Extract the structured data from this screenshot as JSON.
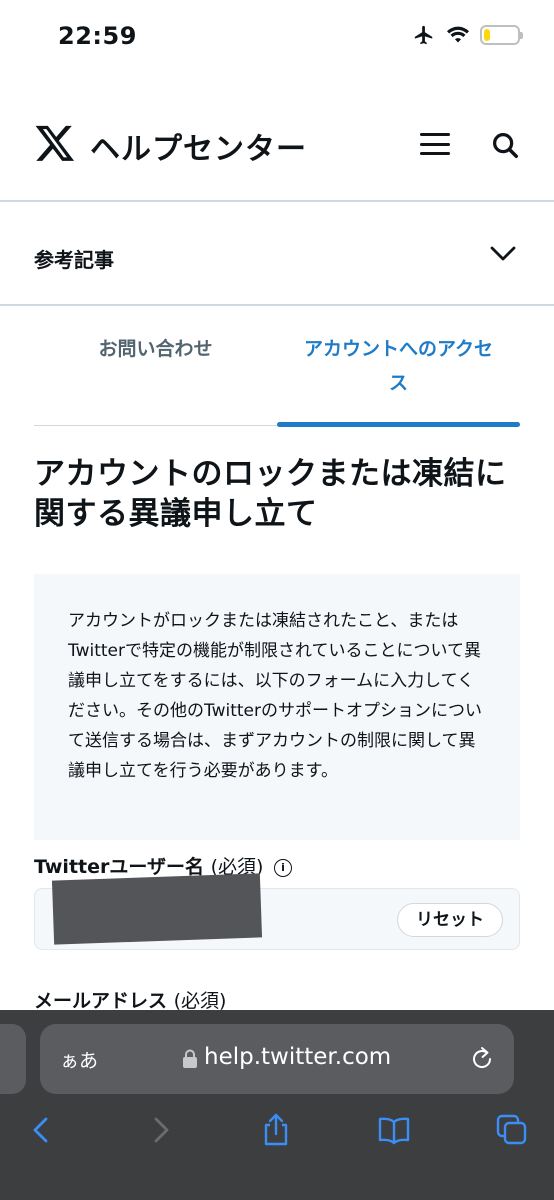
{
  "status_bar": {
    "time": "22:59",
    "battery_level": 0.2,
    "battery_color": "#ffd60a"
  },
  "header": {
    "site_title": "ヘルプセンター",
    "logo_icon": "x-logo-icon",
    "menu_icon": "hamburger-menu-icon",
    "search_icon": "search-icon"
  },
  "related": {
    "label": "参考記事",
    "icon": "chevron-down-icon"
  },
  "tabs": [
    {
      "label": "お問い合わせ",
      "active": false
    },
    {
      "label": "アカウントへのアクセス",
      "active": true
    }
  ],
  "accent_color": "#1d7bc7",
  "page": {
    "title": "アカウントのロックまたは凍結に関する異議申し立て"
  },
  "info_box": {
    "text": "アカウントがロックまたは凍結されたこと、またはTwitterで特定の機能が制限されていることについて異議申し立てをするには、以下のフォームに入力してください。その他のTwitterのサポートオプションについて送信する場合は、まずアカウントの制限に関して異議申し立てを行う必要があります。"
  },
  "form": {
    "username": {
      "label": "Twitterユーザー名",
      "required": "(必須)",
      "info_icon": "info-icon",
      "reset_label": "リセット"
    },
    "email": {
      "label": "メールアドレス",
      "required": "(必須)"
    }
  },
  "safari": {
    "aa_label": "ぁあ",
    "url": "help.twitter.com",
    "icons": [
      "lock-icon",
      "reload-icon",
      "back-icon",
      "forward-icon",
      "share-icon",
      "bookmarks-icon",
      "tabs-icon"
    ]
  }
}
